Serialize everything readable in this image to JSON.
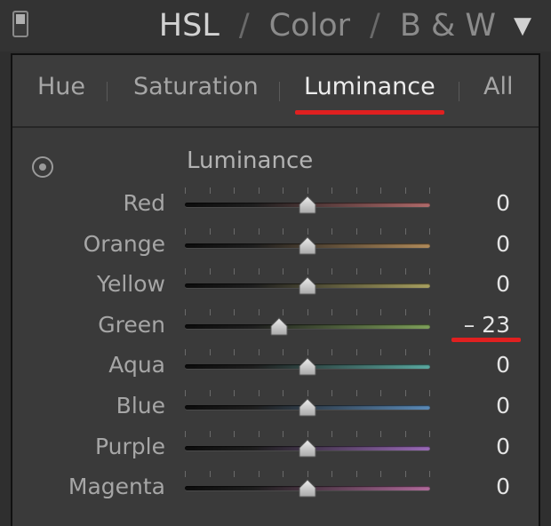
{
  "header": {
    "modes": [
      "HSL",
      "Color",
      "B & W"
    ],
    "separator": "/",
    "menu_glyph": "▼"
  },
  "tabs": [
    "Hue",
    "Saturation",
    "Luminance",
    "All"
  ],
  "active_tab": "Luminance",
  "section": {
    "title": "Luminance",
    "target_icon": "target-adjustment-icon"
  },
  "slider_range": [
    -100,
    100
  ],
  "sliders": [
    {
      "label": "Red",
      "value": 0,
      "display": "0",
      "color": "#b06a6a"
    },
    {
      "label": "Orange",
      "value": 0,
      "display": "0",
      "color": "#b08a5a"
    },
    {
      "label": "Yellow",
      "value": 0,
      "display": "0",
      "color": "#a8a060"
    },
    {
      "label": "Green",
      "value": -23,
      "display": "– 23",
      "color": "#7ea05a"
    },
    {
      "label": "Aqua",
      "value": 0,
      "display": "0",
      "color": "#5aa8a0"
    },
    {
      "label": "Blue",
      "value": 0,
      "display": "0",
      "color": "#5a8ab8"
    },
    {
      "label": "Purple",
      "value": 0,
      "display": "0",
      "color": "#9a6ab8"
    },
    {
      "label": "Magenta",
      "value": 0,
      "display": "0",
      "color": "#b06a9a"
    }
  ],
  "colors": {
    "annotation_red": "#e02020",
    "panel_bg": "#3a3a3a",
    "active_text": "#ececec"
  }
}
